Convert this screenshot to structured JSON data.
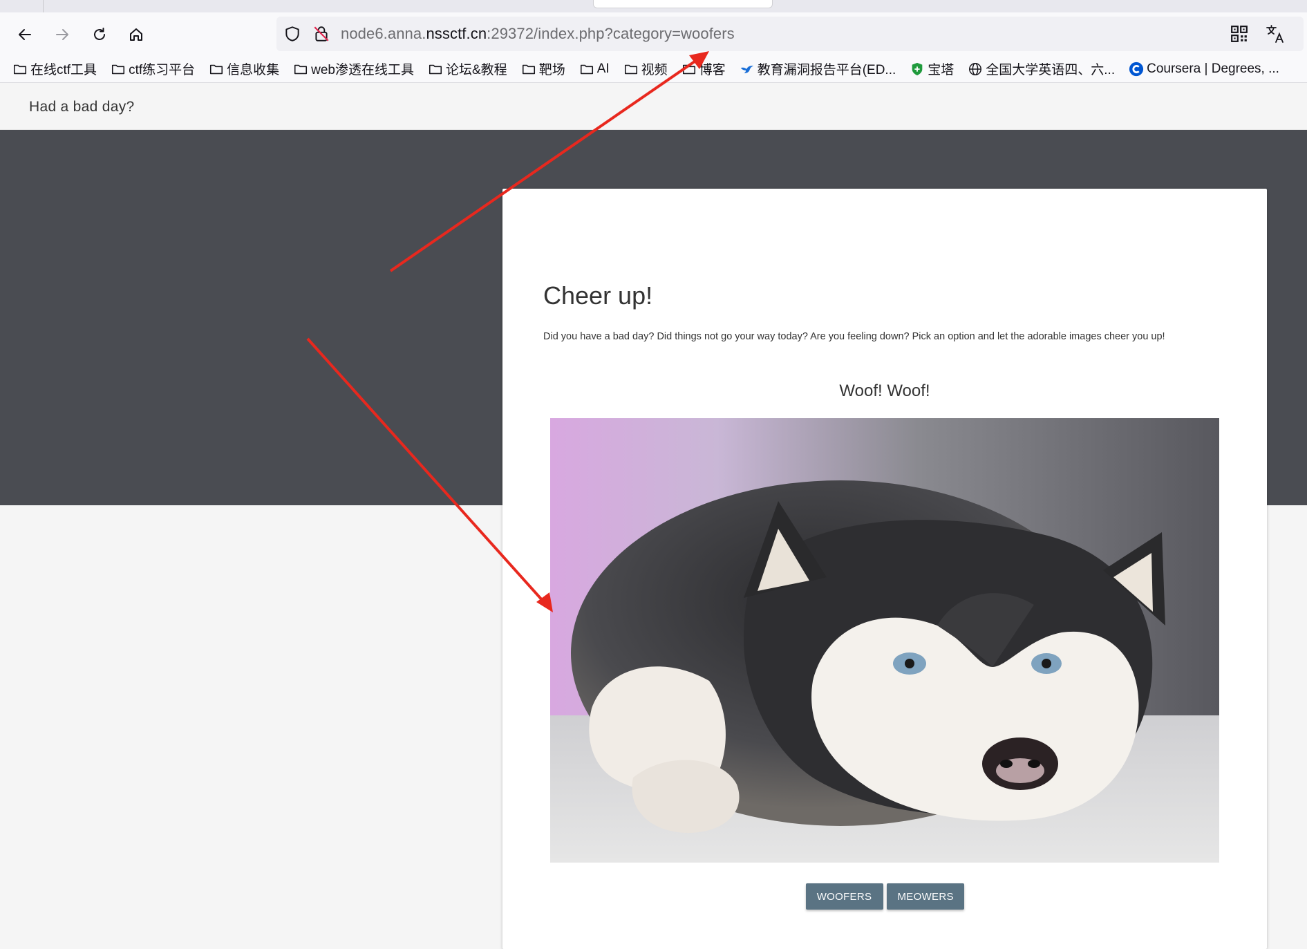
{
  "browser": {
    "url_prefix": "node6.anna.",
    "url_host": "nssctf.cn",
    "url_suffix": ":29372/index.php?category=woofers",
    "bookmarks": [
      {
        "label": "在线ctf工具",
        "icon": "folder-icon"
      },
      {
        "label": "ctf练习平台",
        "icon": "folder-icon"
      },
      {
        "label": "信息收集",
        "icon": "folder-icon"
      },
      {
        "label": "web渗透在线工具",
        "icon": "folder-icon"
      },
      {
        "label": "论坛&教程",
        "icon": "folder-icon"
      },
      {
        "label": "靶场",
        "icon": "folder-icon"
      },
      {
        "label": "AI",
        "icon": "folder-icon"
      },
      {
        "label": "视频",
        "icon": "folder-icon"
      },
      {
        "label": "博客",
        "icon": "folder-icon"
      },
      {
        "label": "教育漏洞报告平台(ED...",
        "icon": "bird-icon"
      },
      {
        "label": "宝塔",
        "icon": "shield-icon"
      },
      {
        "label": "全国大学英语四、六...",
        "icon": "globe-icon"
      },
      {
        "label": "Coursera | Degrees, ...",
        "icon": "coursera-icon"
      }
    ]
  },
  "site": {
    "title": "Had a bad day?"
  },
  "card": {
    "title": "Cheer up!",
    "text": "Did you have a bad day? Did things not go your way today? Are you feeling down? Pick an option and let the adorable images cheer you up!",
    "image_heading": "Woof! Woof!",
    "buttons": {
      "woofers": "WOOFERS",
      "meowers": "MEOWERS"
    }
  },
  "colors": {
    "hero_bg": "#4a4c52",
    "button_bg": "#5a7383",
    "annotation_arrow": "#e8281e"
  }
}
